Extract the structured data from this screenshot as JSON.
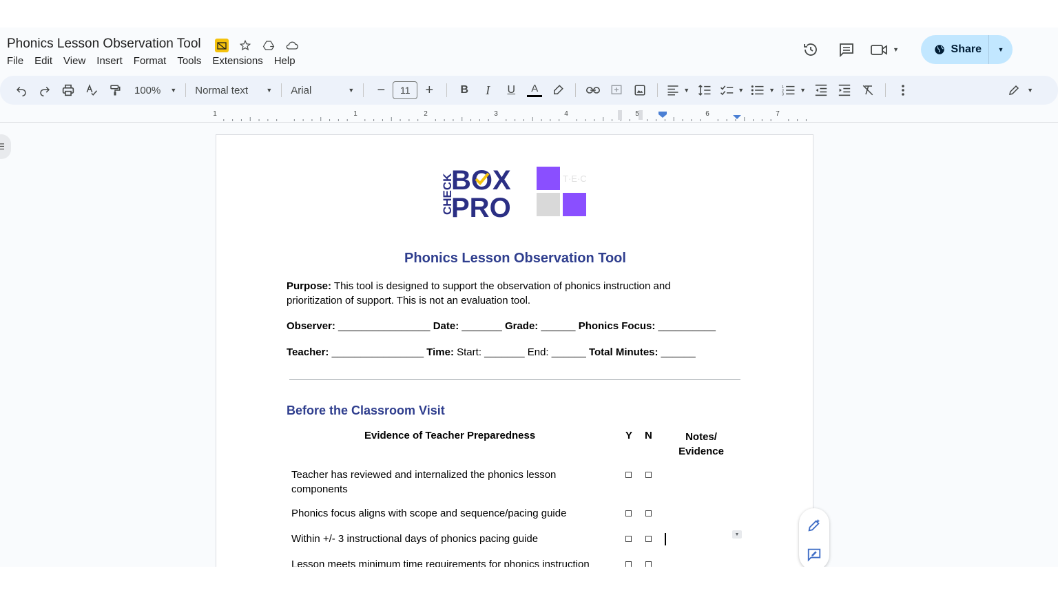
{
  "doc": {
    "title": "Phonics Lesson Observation Tool"
  },
  "menu": [
    "File",
    "Edit",
    "View",
    "Insert",
    "Format",
    "Tools",
    "Extensions",
    "Help"
  ],
  "share_label": "Share",
  "toolbar": {
    "zoom": "100%",
    "style": "Normal text",
    "font": "Arial",
    "font_size": "11",
    "bold": "B",
    "italic": "I",
    "underline": "U",
    "text_color": "A"
  },
  "ruler": {
    "numbers": [
      "1",
      "1",
      "2",
      "3",
      "4",
      "5",
      "6",
      "7"
    ]
  },
  "logo": {
    "text_check": "CHECK",
    "text_box": "BOX",
    "text_pro": "PRO",
    "text_tec": "T·E·C"
  },
  "content": {
    "heading": "Phonics Lesson Observation Tool",
    "purpose_label": "Purpose:",
    "purpose_text": " This tool is designed to support the observation of phonics instruction and prioritization of support. This is not an evaluation tool.",
    "observer_label": "Observer:",
    "observer_blank": " ________________ ",
    "date_label": "Date:",
    "date_blank": " _______ ",
    "grade_label": "Grade:",
    "grade_blank": " ______ ",
    "phonics_focus_label": "Phonics Focus:",
    "phonics_focus_blank": " __________",
    "teacher_label": "Teacher:",
    "teacher_blank": " ________________ ",
    "time_label": "Time:",
    "start_text": " Start: _______ ",
    "end_text": "End: ______ ",
    "total_label": "Total Minutes:",
    "total_blank": " ______",
    "section_title": "Before the Classroom Visit",
    "table": {
      "col_evidence": "Evidence of Teacher Preparedness",
      "col_y": "Y",
      "col_n": "N",
      "col_notes_line1": "Notes/",
      "col_notes_line2": "Evidence",
      "rows": [
        "Teacher has reviewed and internalized the phonics lesson components",
        "Phonics focus aligns with scope and sequence/pacing guide",
        "Within +/- 3 instructional days of phonics pacing guide",
        "Lesson meets minimum time requirements for phonics instruction"
      ]
    }
  },
  "colors": {
    "heading": "#2f3e8e",
    "share_bg": "#c2e7ff",
    "logo_purple": "#8a4fff",
    "logo_navy": "#2b2f84"
  }
}
